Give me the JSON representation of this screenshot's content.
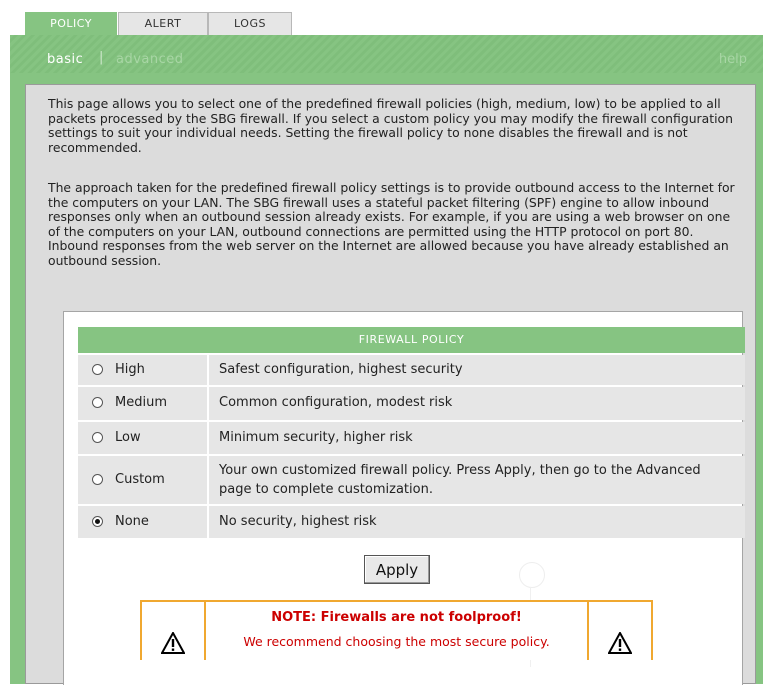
{
  "tabs": [
    {
      "label": "POLICY",
      "active": true
    },
    {
      "label": "ALERT",
      "active": false
    },
    {
      "label": "LOGS",
      "active": false
    }
  ],
  "subnav": {
    "basic": "basic",
    "separator": "|",
    "advanced": "advanced",
    "help": "help"
  },
  "intro": {
    "p1": "This page allows you to select one of the predefined firewall policies (high, medium, low) to be applied to all packets processed by the SBG firewall. If you select a custom policy you may modify the firewall configuration settings to suit your individual needs. Setting the firewall policy to none disables the firewall and is not recommended.",
    "p2": "The approach taken for the predefined firewall policy settings is to provide outbound access to the Internet for the computers on your LAN. The SBG firewall uses a stateful packet filtering (SPF) engine to allow inbound responses only when an outbound session already exists. For example, if you are using a web browser on one of the computers on your LAN, outbound connections are permitted using the HTTP protocol on port 80. Inbound responses from the web server on the Internet are allowed because you have already established an outbound session."
  },
  "policy_table": {
    "header": "FIREWALL POLICY",
    "options": [
      {
        "label": "High",
        "description": "Safest configuration, highest security",
        "selected": false
      },
      {
        "label": "Medium",
        "description": "Common configuration, modest risk",
        "selected": false
      },
      {
        "label": "Low",
        "description": "Minimum security, higher risk",
        "selected": false
      },
      {
        "label": "Custom",
        "description": "Your own customized firewall policy. Press Apply, then go to the Advanced page to complete customization.",
        "selected": false
      },
      {
        "label": "None",
        "description": "No security, highest risk",
        "selected": true
      }
    ]
  },
  "apply_label": "Apply",
  "note": {
    "title": "NOTE: Firewalls are not foolproof!",
    "subtitle": "We recommend choosing the most secure policy."
  },
  "colors": {
    "accent_green": "#86c482",
    "warning_orange": "#f0a830",
    "warning_text": "#cc0000"
  }
}
